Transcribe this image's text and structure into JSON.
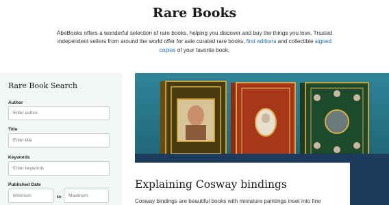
{
  "header": {
    "title": "Rare Books",
    "intro_before": "AbeBooks offers a wonderful selection of rare books, helping you discover and buy the things you love. Trusted independent sellers from around the world offer for sale curated rare books, ",
    "link_first_editions": "first editions",
    "intro_middle": " and collectible ",
    "link_signed_copies": "signed copies",
    "intro_after": " of your favorite book."
  },
  "search": {
    "heading": "Rare Book Search",
    "author_label": "Author",
    "author_placeholder": "Enter author",
    "title_label": "Title",
    "title_placeholder": "Enter title",
    "keywords_label": "Keywords",
    "keywords_placeholder": "Enter keywords",
    "published_label": "Published Date",
    "min_placeholder": "Minimum",
    "to_label": "to",
    "max_placeholder": "Maximum"
  },
  "feature": {
    "heading": "Explaining Cosway bindings",
    "text": "Cosway bindings are beautiful books with miniature paintings inset into fine"
  },
  "colors": {
    "link": "#1a6fa8",
    "sidebar_bg": "#f2f6f7",
    "hero_bg": "#2a7a8c",
    "hero_band": "#1b3a5c"
  }
}
